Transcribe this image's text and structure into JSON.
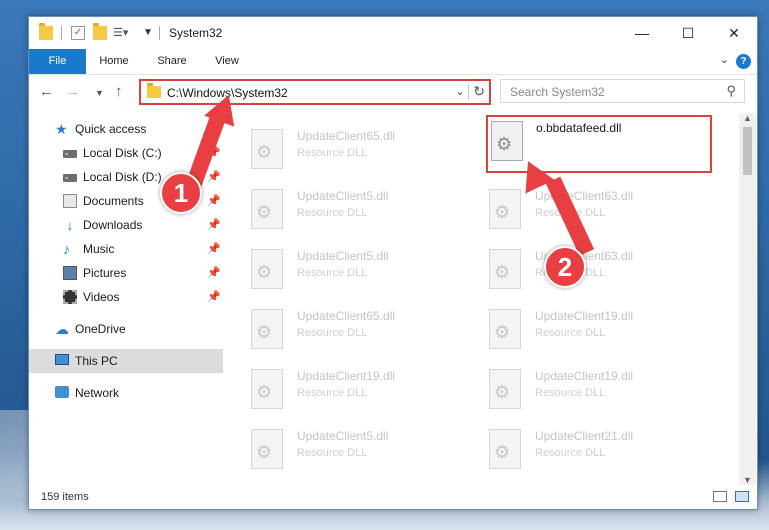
{
  "window": {
    "title": "System32",
    "controls": {
      "minimize": "—",
      "maximize": "☐",
      "close": "✕"
    }
  },
  "ribbon": {
    "tabs": [
      "File",
      "Home",
      "Share",
      "View"
    ],
    "help": "?"
  },
  "address_bar": {
    "path": "C:\\Windows\\System32"
  },
  "search": {
    "placeholder": "Search System32"
  },
  "sidebar": {
    "items": [
      {
        "label": "Quick access",
        "icon": "star-icon"
      },
      {
        "label": "Local Disk (C:)",
        "icon": "drive-icon",
        "pinned": true
      },
      {
        "label": "Local Disk (D:)",
        "icon": "drive-icon",
        "pinned": true
      },
      {
        "label": "Documents",
        "icon": "documents-icon",
        "pinned": true
      },
      {
        "label": "Downloads",
        "icon": "download-icon",
        "pinned": true
      },
      {
        "label": "Music",
        "icon": "music-icon",
        "pinned": true
      },
      {
        "label": "Pictures",
        "icon": "pictures-icon",
        "pinned": true
      },
      {
        "label": "Videos",
        "icon": "videos-icon",
        "pinned": true
      },
      {
        "label": "OneDrive",
        "icon": "cloud-icon"
      },
      {
        "label": "This PC",
        "icon": "computer-icon",
        "selected": true
      },
      {
        "label": "Network",
        "icon": "network-icon"
      }
    ]
  },
  "files": [
    {
      "name": "UpdateClient65.dll",
      "type": "Resource DLL"
    },
    {
      "name": "o.bbdatafeed.dll",
      "type": "",
      "highlighted": true
    },
    {
      "name": "UpdateClient5.dll",
      "type": "Resource DLL"
    },
    {
      "name": "UpdateClient63.dll",
      "type": "Resource DLL"
    },
    {
      "name": "UpdateClient5.dll",
      "type": "Resource DLL"
    },
    {
      "name": "UpdateClient63.dll",
      "type": "Resource DLL"
    },
    {
      "name": "UpdateClient65.dll",
      "type": "Resource DLL"
    },
    {
      "name": "UpdateClient19.dll",
      "type": "Resource DLL"
    },
    {
      "name": "UpdateClient19.dll",
      "type": "Resource DLL"
    },
    {
      "name": "UpdateClient19.dll",
      "type": "Resource DLL"
    },
    {
      "name": "UpdateClient5.dll",
      "type": "Resource DLL"
    },
    {
      "name": "UpdateClient21.dll",
      "type": "Resource DLL"
    }
  ],
  "status": {
    "item_count": "159 items"
  },
  "annotations": {
    "step1": "1",
    "step2": "2"
  },
  "colors": {
    "accent": "#1979ca",
    "highlight": "#d9413f",
    "arrow": "#e84042"
  }
}
